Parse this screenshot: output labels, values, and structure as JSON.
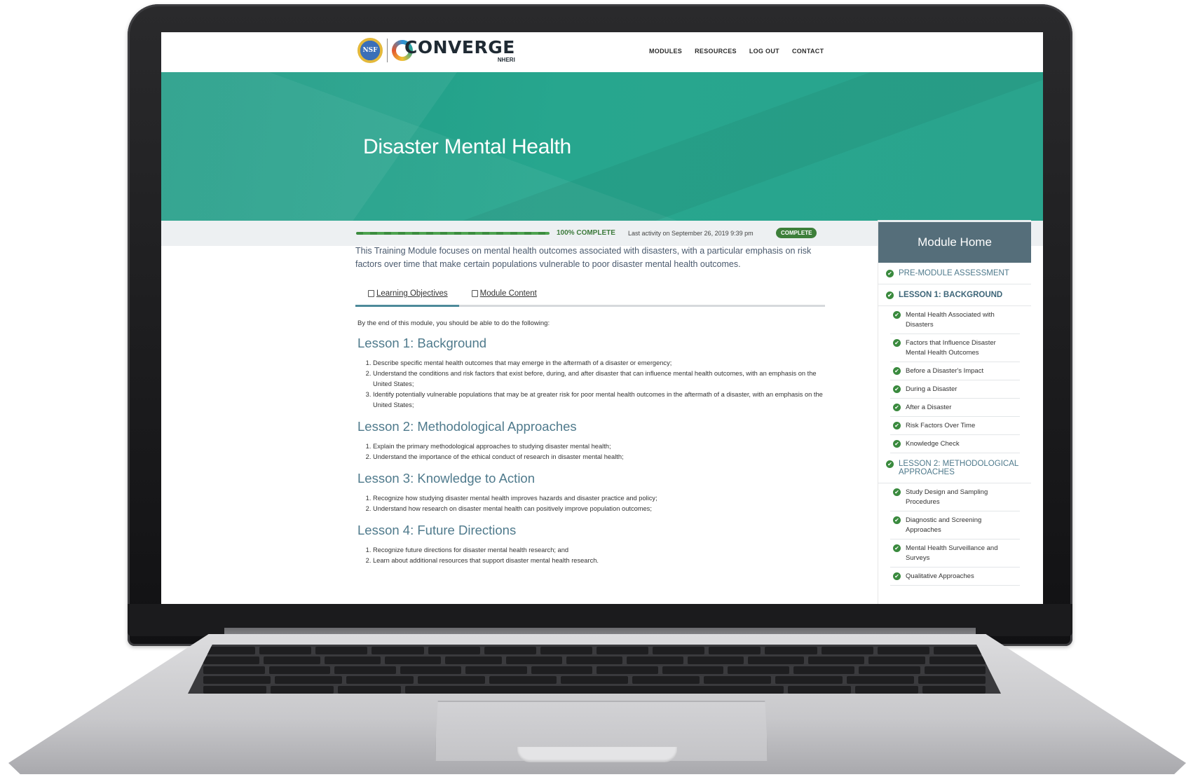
{
  "nav": {
    "logo_seal_text": "NSF",
    "logo_text": "CONVERGE",
    "logo_subtext": "NHERI",
    "links": [
      "MODULES",
      "RESOURCES",
      "LOG OUT",
      "CONTACT"
    ]
  },
  "hero": {
    "title": "Disaster Mental Health"
  },
  "progress": {
    "percent": 100,
    "label": "100% COMPLETE",
    "last_activity": "Last activity on September 26, 2019 9:39 pm",
    "badge": "COMPLETE"
  },
  "intro": "This Training Module focuses on mental health outcomes associated with disasters, with a particular emphasis on risk factors over time that make certain populations vulnerable to poor disaster mental health outcomes.",
  "tabs": [
    {
      "label": "Learning Objectives",
      "icon": "document-icon",
      "active": true
    },
    {
      "label": "Module Content",
      "icon": "book-icon",
      "active": false
    }
  ],
  "objectives_intro": "By the end of this module, you should be able to do the following:",
  "lessons": [
    {
      "title": "Lesson 1: Background",
      "items": [
        "Describe specific mental health outcomes that may emerge in the aftermath of a disaster or emergency;",
        "Understand the conditions and risk factors that exist before, during, and after disaster that can influence mental health outcomes, with an emphasis on the United States;",
        "Identify potentially vulnerable populations that may be at greater risk for poor mental health outcomes in the aftermath of a disaster, with an emphasis on the United States;"
      ]
    },
    {
      "title": "Lesson 2: Methodological Approaches",
      "items": [
        "Explain the primary methodological approaches to studying disaster mental health;",
        "Understand the importance of the ethical conduct of research in disaster mental health;"
      ]
    },
    {
      "title": "Lesson 3: Knowledge to Action",
      "items": [
        "Recognize how studying disaster mental health improves hazards and disaster practice and policy;",
        "Understand how research on disaster mental health can positively improve population outcomes;"
      ]
    },
    {
      "title": "Lesson 4: Future Directions",
      "items": [
        "Recognize future directions for disaster mental health research; and",
        "Learn about additional resources that support disaster mental health research."
      ]
    }
  ],
  "sidebar": {
    "title": "Module Home",
    "check_glyph": "✔",
    "items": [
      {
        "label": "PRE-MODULE ASSESSMENT",
        "type": "lesson"
      },
      {
        "label": "LESSON 1: BACKGROUND",
        "type": "lesson-bold"
      },
      {
        "label": "Mental Health Associated with Disasters",
        "type": "sub"
      },
      {
        "label": "Factors that Influence Disaster Mental Health Outcomes",
        "type": "sub"
      },
      {
        "label": "Before a Disaster's Impact",
        "type": "sub"
      },
      {
        "label": "During a Disaster",
        "type": "sub"
      },
      {
        "label": "After a Disaster",
        "type": "sub"
      },
      {
        "label": "Risk Factors Over Time",
        "type": "sub"
      },
      {
        "label": "Knowledge Check",
        "type": "sub"
      },
      {
        "label": "LESSON 2: METHODOLOGICAL APPROACHES",
        "type": "lesson"
      },
      {
        "label": "Study Design and Sampling Procedures",
        "type": "sub"
      },
      {
        "label": "Diagnostic and Screening Approaches",
        "type": "sub"
      },
      {
        "label": "Mental Health Surveillance and Surveys",
        "type": "sub"
      },
      {
        "label": "Qualitative Approaches",
        "type": "sub"
      }
    ]
  },
  "colors": {
    "hero_teal": "#27a68e",
    "progress_green": "#3d7f3a",
    "heading_blue": "#4f7a8c",
    "sidebar_header": "#556e7a"
  }
}
